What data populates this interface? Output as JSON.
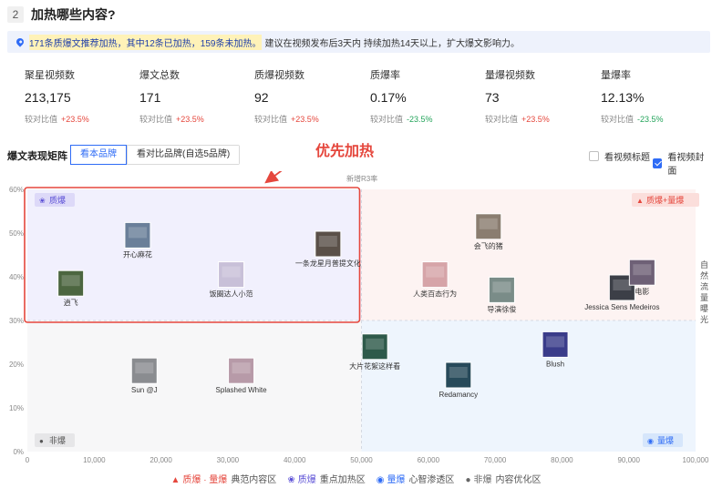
{
  "section": {
    "number": "2",
    "title": "加热哪些内容?"
  },
  "banner": {
    "highlight": "171条质爆文推荐加热，其中12条已加热，159条未加热。",
    "rest": "建议在视频发布后3天内 持续加热14天以上，扩大爆文影响力。"
  },
  "metrics": [
    {
      "label": "聚星视频数",
      "value": "213,175",
      "compare_label": "较对比值",
      "delta": "+23.5%",
      "trend": "up"
    },
    {
      "label": "爆文总数",
      "value": "171",
      "compare_label": "较对比值",
      "delta": "+23.5%",
      "trend": "up"
    },
    {
      "label": "质爆视频数",
      "value": "92",
      "compare_label": "较对比值",
      "delta": "+23.5%",
      "trend": "up"
    },
    {
      "label": "质爆率",
      "value": "0.17%",
      "compare_label": "较对比值",
      "delta": "-23.5%",
      "trend": "down"
    },
    {
      "label": "量爆视频数",
      "value": "73",
      "compare_label": "较对比值",
      "delta": "+23.5%",
      "trend": "up"
    },
    {
      "label": "量爆率",
      "value": "12.13%",
      "compare_label": "较对比值",
      "delta": "-23.5%",
      "trend": "down"
    }
  ],
  "matrix": {
    "title": "爆文表现矩阵",
    "tabs": [
      "看本品牌",
      "看对比品牌(自选5品牌)"
    ],
    "active_tab": 0,
    "checkboxes": [
      {
        "label": "看视频标题",
        "checked": false
      },
      {
        "label": "看视频封面",
        "checked": true
      }
    ],
    "annotation": "优先加热"
  },
  "colors": {
    "accent": "#2f6cf6",
    "red": "#e5473d",
    "green": "#23a45a",
    "purple": "#5b4fd6",
    "quad_top_left": "#f1f0fd",
    "quad_top_right": "#fdf3f2",
    "quad_bottom_right": "#eef5fd",
    "quad_bottom_left": "#f7f7f8"
  },
  "chart_data": {
    "type": "scatter",
    "title": "新增R3率",
    "ylabel": "自然流量曝光",
    "xlabel": "",
    "xlim": [
      0,
      100000
    ],
    "ylim": [
      0,
      60
    ],
    "x_ticks": [
      "0",
      "10,000",
      "20,000",
      "30,000",
      "40,000",
      "50,000",
      "60,000",
      "70,000",
      "80,000",
      "90,000",
      "100,000"
    ],
    "y_ticks": [
      "0%",
      "10%",
      "20%",
      "30%",
      "40%",
      "50%",
      "60%"
    ],
    "divider": {
      "x": 50000,
      "y": 30
    },
    "quadrants": [
      {
        "label": "质爆",
        "position": "top-left",
        "icon": "sprout-icon"
      },
      {
        "label": "质爆+量爆",
        "position": "top-right",
        "icon": "flame-icon"
      },
      {
        "label": "量爆",
        "position": "bottom-right",
        "icon": "badge-check-icon"
      },
      {
        "label": "非爆",
        "position": "bottom-left",
        "icon": "dots-icon"
      }
    ],
    "points": [
      {
        "name": "开心麻花",
        "x": 16500,
        "y": 49.5,
        "thumb": "#6a7f99"
      },
      {
        "name": "逍飞",
        "x": 6500,
        "y": 38.5,
        "thumb": "#4c6640"
      },
      {
        "name": "饭圈达人小范",
        "x": 30500,
        "y": 40.5,
        "thumb": "#c8c0d8"
      },
      {
        "name": "一条龙星月普提文化",
        "x": 45000,
        "y": 47.5,
        "thumb": "#5a5048"
      },
      {
        "name": "会飞的猪",
        "x": 69000,
        "y": 51.5,
        "thumb": "#8a7d70"
      },
      {
        "name": "人类百态行为",
        "x": 61000,
        "y": 40.5,
        "thumb": "#d6a4a8"
      },
      {
        "name": "导演徐俊",
        "x": 71000,
        "y": 37.0,
        "thumb": "#7a8c88"
      },
      {
        "name": "Jessica Sens Medeiros",
        "x": 89000,
        "y": 37.5,
        "thumb": "#3c3f47"
      },
      {
        "name": "电影",
        "x": 92000,
        "y": 41.0,
        "thumb": "#6e6076"
      },
      {
        "name": "大片花絮这样看",
        "x": 52000,
        "y": 24.0,
        "thumb": "#2e5a4a"
      },
      {
        "name": "Blush",
        "x": 79000,
        "y": 24.5,
        "thumb": "#3a3c8a"
      },
      {
        "name": "Redamancy",
        "x": 64500,
        "y": 17.5,
        "thumb": "#274a5a"
      },
      {
        "name": "Sun @J",
        "x": 17500,
        "y": 18.5,
        "thumb": "#8a8c90"
      },
      {
        "name": "Splashed White",
        "x": 32000,
        "y": 18.5,
        "thumb": "#b79aa8"
      }
    ]
  },
  "legend": [
    {
      "label": "质爆 · 量爆",
      "desc": "典范内容区",
      "icon": "flame-icon",
      "color": "#e5473d"
    },
    {
      "label": "质爆",
      "desc": "重点加热区",
      "icon": "sprout-icon",
      "color": "#5b4fd6"
    },
    {
      "label": "量爆",
      "desc": "心智渗透区",
      "icon": "badge-check-icon",
      "color": "#2f6cf6"
    },
    {
      "label": "非爆",
      "desc": "内容优化区",
      "icon": "dots-icon",
      "color": "#666666"
    }
  ]
}
